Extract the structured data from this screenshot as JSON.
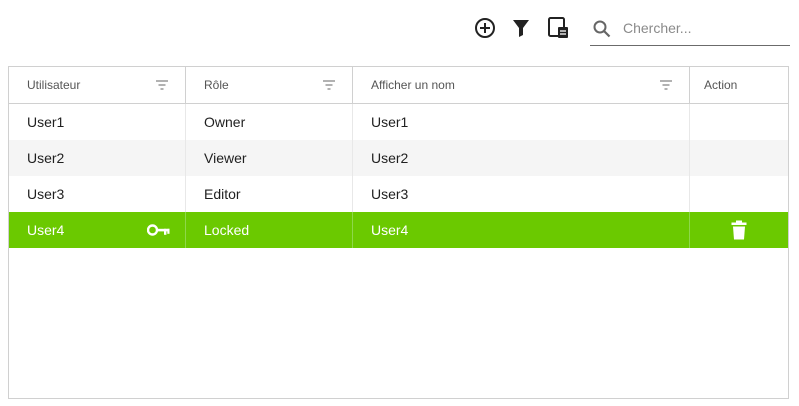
{
  "toolbar": {
    "add_icon": "add-circle-icon",
    "filter_icon": "filter-icon",
    "columns_icon": "column-chooser-icon",
    "search": {
      "placeholder": "Chercher...",
      "value": "",
      "icon": "search-icon"
    }
  },
  "grid": {
    "columns": [
      "Utilisateur",
      "Rôle",
      "Afficher un nom",
      "Action"
    ],
    "rows": [
      {
        "user": "User1",
        "role": "Owner",
        "display": "User1"
      },
      {
        "user": "User2",
        "role": "Viewer",
        "display": "User2"
      },
      {
        "user": "User3",
        "role": "Editor",
        "display": "User3"
      },
      {
        "user": "User4",
        "role": "Locked",
        "display": "User4",
        "selected": true,
        "icons": [
          "key-icon",
          "trash-icon"
        ]
      }
    ],
    "colors": {
      "selected_row": "#6bc900",
      "alt_row": "#f5f5f5",
      "border": "#d0d0d0"
    }
  }
}
